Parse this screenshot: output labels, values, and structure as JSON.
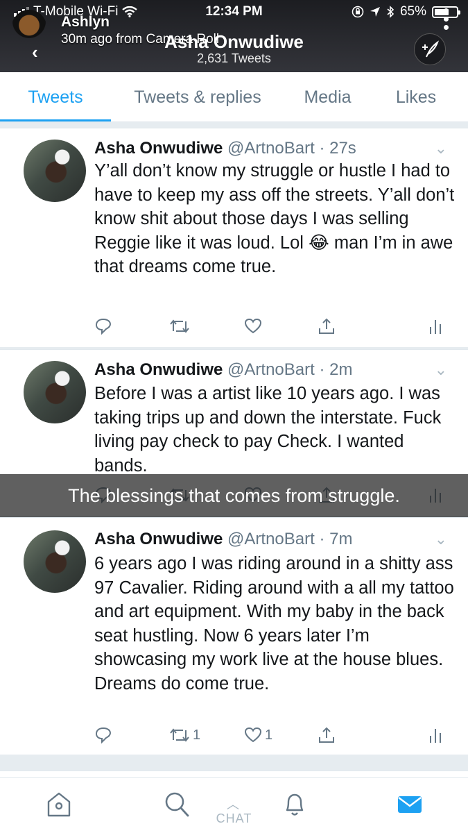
{
  "status_bar": {
    "carrier": "T-Mobile Wi-Fi",
    "time": "12:34 PM",
    "battery": "65%",
    "battery_level": 0.65
  },
  "snap_overlay": {
    "name": "Ashlyn",
    "subtitle": "30m ago from Camera Roll"
  },
  "profile": {
    "name": "Asha Onwudiwe",
    "tweet_count": "2,631 Tweets"
  },
  "tabs": [
    {
      "label": "Tweets",
      "active": true
    },
    {
      "label": "Tweets & replies",
      "active": false
    },
    {
      "label": "Media",
      "active": false
    },
    {
      "label": "Likes",
      "active": false
    }
  ],
  "tweets": [
    {
      "name": "Asha Onwudiwe",
      "meta": "@ArtnoBart · 27s",
      "text": "Y’all don’t know my struggle or hustle I had to have to keep my ass off the streets. Y’all don’t know shit about those days I was selling Reggie like it was loud. Lol 😂 man I’m in awe that dreams come true.",
      "retweets": "",
      "likes": ""
    },
    {
      "name": "Asha Onwudiwe",
      "meta": "@ArtnoBart · 2m",
      "text": "Before I was a artist like 10 years ago. I was taking trips up and down the interstate. Fuck living pay check to pay Check. I wanted bands.",
      "retweets": "",
      "likes": ""
    },
    {
      "name": "Asha Onwudiwe",
      "meta": "@ArtnoBart · 7m",
      "text": "6 years ago I was riding around in a shitty ass 97 Cavalier. Riding around with a all my tattoo and art equipment. With my baby in the back seat hustling. Now 6 years later I’m showcasing my work live at the house blues. Dreams do come true.",
      "retweets": "1",
      "likes": "1"
    }
  ],
  "caption": "The blessings that comes from struggle.",
  "bottom_nav": {
    "chat_label": "CHAT"
  },
  "colors": {
    "accent": "#1da1f2",
    "secondary_text": "#657786"
  }
}
